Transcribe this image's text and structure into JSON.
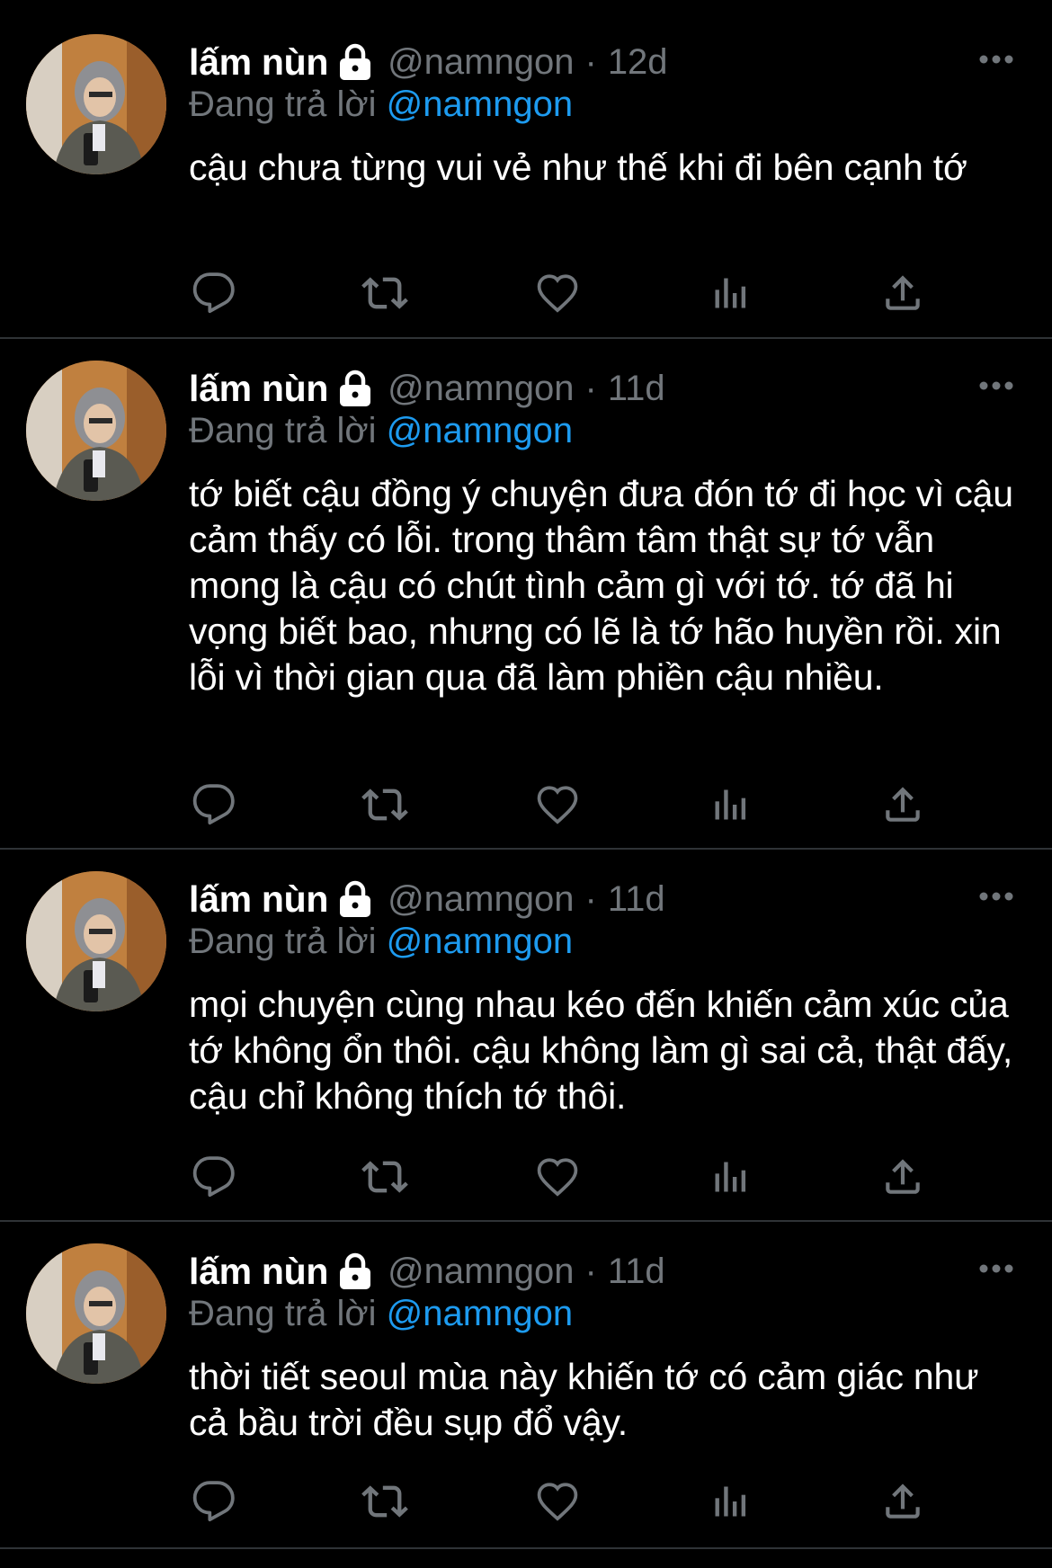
{
  "colors": {
    "background": "#000000",
    "text": "#ffffff",
    "secondary": "#71767b",
    "accent": "#1d9bf0",
    "divider": "#2f3336"
  },
  "icons": {
    "lock": "lock-icon",
    "more": "more-horizontal-icon",
    "reply": "reply-icon",
    "retweet": "retweet-icon",
    "like": "like-icon",
    "views": "views-icon",
    "share": "share-icon"
  },
  "tweets": [
    {
      "name": "lấm nùn",
      "handle": "@namngon",
      "separator": "·",
      "time": "12d",
      "reply_prefix": "Đang trả lời",
      "reply_to": "@namngon",
      "text": "cậu chưa từng vui vẻ như thế khi đi bên cạnh tớ"
    },
    {
      "name": "lấm nùn",
      "handle": "@namngon",
      "separator": "·",
      "time": "11d",
      "reply_prefix": "Đang trả lời",
      "reply_to": "@namngon",
      "text": "tớ biết cậu đồng ý chuyện đưa đón tớ đi học vì cậu cảm thấy có lỗi. trong thâm tâm thật sự tớ vẫn mong là cậu có chút tình cảm gì với tớ. tớ đã hi vọng biết bao, nhưng có lẽ là tớ hão huyền rồi. xin lỗi vì thời gian qua đã làm phiền cậu nhiều."
    },
    {
      "name": "lấm nùn",
      "handle": "@namngon",
      "separator": "·",
      "time": "11d",
      "reply_prefix": "Đang trả lời",
      "reply_to": "@namngon",
      "text": "mọi chuyện cùng nhau kéo đến khiến cảm xúc của tớ không ổn thôi. cậu không làm gì sai cả, thật đấy, cậu chỉ không thích tớ thôi."
    },
    {
      "name": "lấm nùn",
      "handle": "@namngon",
      "separator": "·",
      "time": "11d",
      "reply_prefix": "Đang trả lời",
      "reply_to": "@namngon",
      "text": "thời tiết seoul mùa này khiến tớ có cảm giác như cả bầu trời đều sụp đổ vậy."
    }
  ]
}
